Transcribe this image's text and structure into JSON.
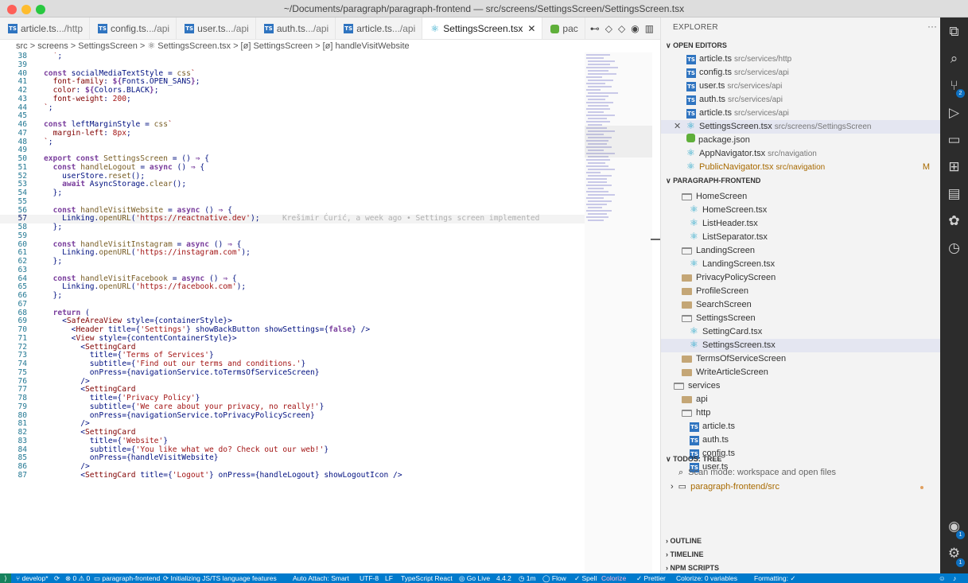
{
  "window": {
    "title": "~/Documents/paragraph/paragraph-frontend — src/screens/SettingsScreen/SettingsScreen.tsx"
  },
  "tabs": [
    {
      "label": "article.ts",
      "desc": " .../http",
      "icon": "ts"
    },
    {
      "label": "config.ts",
      "desc": " .../api",
      "icon": "ts"
    },
    {
      "label": "user.ts",
      "desc": " .../api",
      "icon": "ts"
    },
    {
      "label": "auth.ts",
      "desc": " .../api",
      "icon": "ts"
    },
    {
      "label": "article.ts",
      "desc": " .../api",
      "icon": "ts"
    },
    {
      "label": "SettingsScreen.tsx",
      "desc": "",
      "icon": "react"
    },
    {
      "label": "pac",
      "desc": "",
      "icon": "package"
    }
  ],
  "breadcrumb": "src > screens > SettingsScreen > ⚛ SettingsScreen.tsx > [ø] SettingsScreen > [ø] handleVisitWebsite",
  "code": {
    "current_line": "57",
    "blame": "Krešimir Ćurić, a week ago • Settings screen implemented",
    "lines": [
      {
        "n": "38",
        "h": "  <span class=\"s\">`</span>;"
      },
      {
        "n": "39",
        "h": ""
      },
      {
        "n": "40",
        "h": "<span class=\"k\">const</span> socialMediaTextStyle = <span class=\"f\">css</span><span class=\"s\">`</span>"
      },
      {
        "n": "41",
        "h": "  <span class=\"t\">font-family</span>: <span class=\"k\">${</span>Fonts.<span class=\"v\">OPEN_SANS</span><span class=\"k\">}</span>;"
      },
      {
        "n": "42",
        "h": "  <span class=\"t\">color</span>: <span class=\"k\">${</span>Colors.<span class=\"v\">BLACK</span><span class=\"k\">}</span>;"
      },
      {
        "n": "43",
        "h": "  <span class=\"t\">font-weight</span>: <span class=\"s\">200</span>;"
      },
      {
        "n": "44",
        "h": "<span class=\"s\">`</span>;"
      },
      {
        "n": "45",
        "h": ""
      },
      {
        "n": "46",
        "h": "<span class=\"k\">const</span> leftMarginStyle = <span class=\"f\">css</span><span class=\"s\">`</span>"
      },
      {
        "n": "47",
        "h": "  <span class=\"t\">margin-left</span>: <span class=\"s\">8px</span>;"
      },
      {
        "n": "48",
        "h": "<span class=\"s\">`</span>;"
      },
      {
        "n": "49",
        "h": ""
      },
      {
        "n": "50",
        "h": "<span class=\"k\">export const</span> <span class=\"f\">SettingsScreen</span> = () <span class=\"k\">⇒</span> {"
      },
      {
        "n": "51",
        "h": "  <span class=\"k\">const</span> <span class=\"f\">handleLogout</span> = <span class=\"k\">async</span> () <span class=\"k\">⇒</span> {"
      },
      {
        "n": "52",
        "h": "    userStore.<span class=\"f\">reset</span>();"
      },
      {
        "n": "53",
        "h": "    <span class=\"k\">await</span> AsyncStorage.<span class=\"f\">clear</span>();"
      },
      {
        "n": "54",
        "h": "  };"
      },
      {
        "n": "55",
        "h": ""
      },
      {
        "n": "56",
        "h": "  <span class=\"k\">const</span> <span class=\"f\">handleVisitWebsite</span> = <span class=\"k\">async</span> () <span class=\"k\">⇒</span> {"
      },
      {
        "n": "57",
        "h": "    Linking.<span class=\"f\">openURL</span>(<span class=\"s\">'https://reactnative.dev'</span>);"
      },
      {
        "n": "58",
        "h": "  };"
      },
      {
        "n": "59",
        "h": ""
      },
      {
        "n": "60",
        "h": "  <span class=\"k\">const</span> <span class=\"f\">handleVisitInstagram</span> = <span class=\"k\">async</span> () <span class=\"k\">⇒</span> {"
      },
      {
        "n": "61",
        "h": "    Linking.<span class=\"f\">openURL</span>(<span class=\"s\">'https://instagram.com'</span>);"
      },
      {
        "n": "62",
        "h": "  };"
      },
      {
        "n": "63",
        "h": ""
      },
      {
        "n": "64",
        "h": "  <span class=\"k\">const</span> <span class=\"f\">handleVisitFacebook</span> = <span class=\"k\">async</span> () <span class=\"k\">⇒</span> {"
      },
      {
        "n": "65",
        "h": "    Linking.<span class=\"f\">openURL</span>(<span class=\"s\">'https://facebook.com'</span>);"
      },
      {
        "n": "66",
        "h": "  };"
      },
      {
        "n": "67",
        "h": ""
      },
      {
        "n": "68",
        "h": "  <span class=\"k\">return</span> ("
      },
      {
        "n": "69",
        "h": "    &lt;<span class=\"t\">SafeAreaView</span> <span class=\"v\">style</span>={containerStyle}&gt;"
      },
      {
        "n": "70",
        "h": "      &lt;<span class=\"t\">Header</span> <span class=\"v\">title</span>={<span class=\"s\">'Settings'</span>} <span class=\"v\">showBackButton</span> <span class=\"v\">showSettings</span>={<span class=\"k\">false</span>} /&gt;"
      },
      {
        "n": "71",
        "h": "      &lt;<span class=\"t\">View</span> <span class=\"v\">style</span>={contentContainerStyle}&gt;"
      },
      {
        "n": "72",
        "h": "        &lt;<span class=\"t\">SettingCard</span>"
      },
      {
        "n": "73",
        "h": "          <span class=\"v\">title</span>={<span class=\"s\">'Terms of Services'</span>}"
      },
      {
        "n": "74",
        "h": "          <span class=\"v\">subtitle</span>={<span class=\"s\">'Find out our terms and conditions.'</span>}"
      },
      {
        "n": "75",
        "h": "          <span class=\"v\">onPress</span>={navigationService.toTermsOfServiceScreen}"
      },
      {
        "n": "76",
        "h": "        /&gt;"
      },
      {
        "n": "77",
        "h": "        &lt;<span class=\"t\">SettingCard</span>"
      },
      {
        "n": "78",
        "h": "          <span class=\"v\">title</span>={<span class=\"s\">'Privacy Policy'</span>}"
      },
      {
        "n": "79",
        "h": "          <span class=\"v\">subtitle</span>={<span class=\"s\">'We care about your privacy, no really!'</span>}"
      },
      {
        "n": "80",
        "h": "          <span class=\"v\">onPress</span>={navigationService.toPrivacyPolicyScreen}"
      },
      {
        "n": "81",
        "h": "        /&gt;"
      },
      {
        "n": "82",
        "h": "        &lt;<span class=\"t\">SettingCard</span>"
      },
      {
        "n": "83",
        "h": "          <span class=\"v\">title</span>={<span class=\"s\">'Website'</span>}"
      },
      {
        "n": "84",
        "h": "          <span class=\"v\">subtitle</span>={<span class=\"s\">'You like what we do? Check out our web!'</span>}"
      },
      {
        "n": "85",
        "h": "          <span class=\"v\">onPress</span>={handleVisitWebsite}"
      },
      {
        "n": "86",
        "h": "        /&gt;"
      },
      {
        "n": "87",
        "h": "        &lt;<span class=\"t\">SettingCard</span> <span class=\"v\">title</span>={<span class=\"s\">'Logout'</span>} <span class=\"v\">onPress</span>={handleLogout} <span class=\"v\">showLogoutIcon</span> /&gt;"
      }
    ]
  },
  "explorer": {
    "title": "EXPLORER",
    "more": "···",
    "open_editors_header": "∨ OPEN EDITORS",
    "open_editors": [
      {
        "label": "article.ts",
        "desc": "src/services/http",
        "icon": "ts"
      },
      {
        "label": "config.ts",
        "desc": "src/services/api",
        "icon": "ts"
      },
      {
        "label": "user.ts",
        "desc": "src/services/api",
        "icon": "ts"
      },
      {
        "label": "auth.ts",
        "desc": "src/services/api",
        "icon": "ts"
      },
      {
        "label": "article.ts",
        "desc": "src/services/api",
        "icon": "ts"
      },
      {
        "label": "SettingsScreen.tsx",
        "desc": "src/screens/SettingsScreen",
        "icon": "react",
        "selected": true
      },
      {
        "label": "package.json",
        "desc": "",
        "icon": "package"
      },
      {
        "label": "AppNavigator.tsx",
        "desc": "src/navigation",
        "icon": "react"
      },
      {
        "label": "PublicNavigator.tsx",
        "desc": "src/navigation",
        "icon": "react",
        "modified": "M"
      }
    ],
    "project_header": "∨ PARAGRAPH-FRONTEND",
    "tree": [
      {
        "label": "HomeScreen",
        "icon": "folder-open",
        "indent": 1
      },
      {
        "label": "HomeScreen.tsx",
        "icon": "react",
        "indent": 2
      },
      {
        "label": "ListHeader.tsx",
        "icon": "react",
        "indent": 2
      },
      {
        "label": "ListSeparator.tsx",
        "icon": "react",
        "indent": 2
      },
      {
        "label": "LandingScreen",
        "icon": "folder-open",
        "indent": 1
      },
      {
        "label": "LandingScreen.tsx",
        "icon": "react",
        "indent": 2
      },
      {
        "label": "PrivacyPolicyScreen",
        "icon": "folder",
        "indent": 1
      },
      {
        "label": "ProfileScreen",
        "icon": "folder",
        "indent": 1
      },
      {
        "label": "SearchScreen",
        "icon": "folder",
        "indent": 1
      },
      {
        "label": "SettingsScreen",
        "icon": "folder-open",
        "indent": 1
      },
      {
        "label": "SettingCard.tsx",
        "icon": "react",
        "indent": 2
      },
      {
        "label": "SettingsScreen.tsx",
        "icon": "react",
        "indent": 2,
        "selected": true
      },
      {
        "label": "TermsOfServiceScreen",
        "icon": "folder",
        "indent": 1
      },
      {
        "label": "WriteArticleScreen",
        "icon": "folder",
        "indent": 1
      },
      {
        "label": "services",
        "icon": "folder-open",
        "indent": 0
      },
      {
        "label": "api",
        "icon": "folder",
        "indent": 1
      },
      {
        "label": "http",
        "icon": "folder-open",
        "indent": 1
      },
      {
        "label": "article.ts",
        "icon": "ts",
        "indent": 2
      },
      {
        "label": "auth.ts",
        "icon": "ts",
        "indent": 2
      },
      {
        "label": "config.ts",
        "icon": "ts",
        "indent": 2
      },
      {
        "label": "user.ts",
        "icon": "ts",
        "indent": 2
      }
    ],
    "todos_header": "∨ TODOS: TREE",
    "todos_scan": "Scan mode: workspace and open files",
    "todos_root": "paragraph-frontend/src",
    "outline": "› OUTLINE",
    "timeline": "› TIMELINE",
    "npm_scripts": "› NPM SCRIPTS"
  },
  "activity": {
    "scm_badge": "2",
    "accounts_badge": "1",
    "settings_badge": "1"
  },
  "status": {
    "branch": "develop*",
    "sync": "⟳",
    "problems": "⊗ 0 ⚠ 0",
    "folder": "▭ paragraph-frontend",
    "initializing": "⟳ Initializing JS/TS language features",
    "auto_attach": "Auto Attach: Smart",
    "encoding": "UTF-8",
    "eol": "LF",
    "language": "TypeScript React",
    "go_live": "◎ Go Live",
    "ts_version": "4.4.2",
    "time": "◷ 1m",
    "flow": "◯ Flow",
    "spell": "✓ Spell",
    "colorize": "Colorize",
    "prettier": "✓ Prettier",
    "colorize_vars": "Colorize: 0 variables",
    "formatting": "Formatting: ✓"
  },
  "colors": {
    "accent": "#007acc",
    "selection": "#e4e6f1",
    "modified": "#a86a00"
  }
}
